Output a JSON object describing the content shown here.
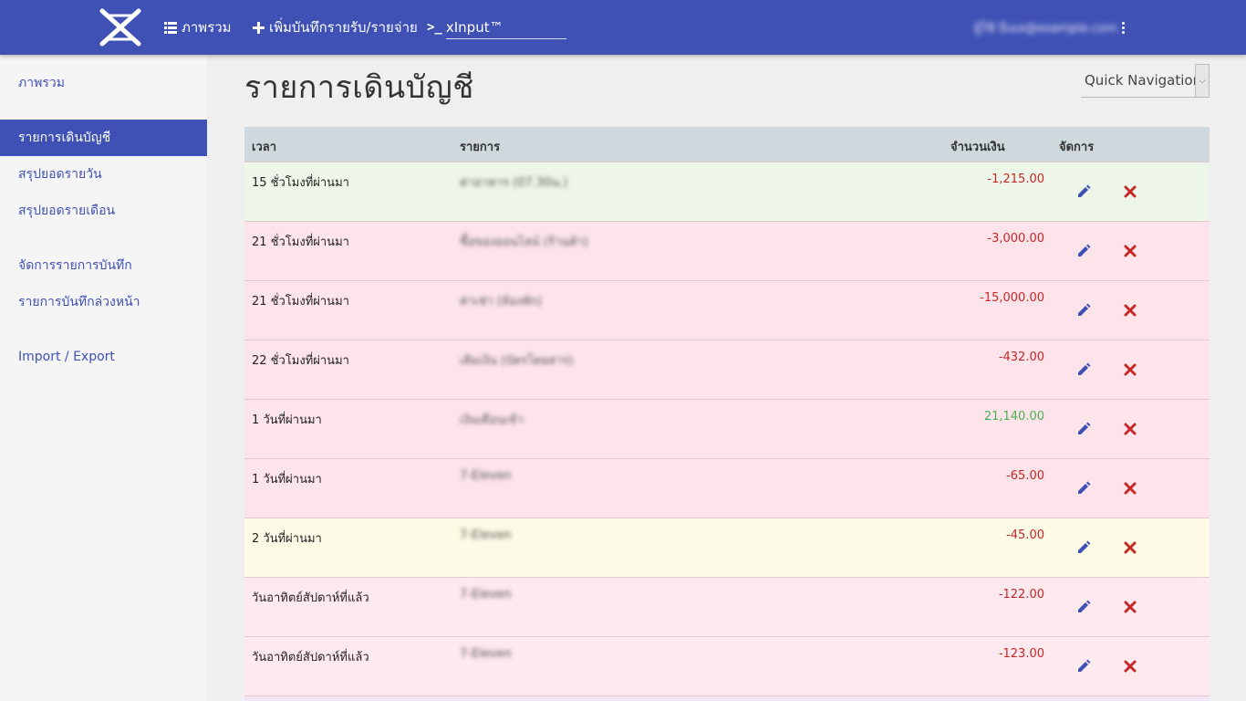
{
  "topbar": {
    "nav_overview": "ภาพรวม",
    "nav_add": "เพิ่มบันทึกรายรับ/รายจ่าย",
    "xinput_prompt": ">_",
    "xinput_value": "xInput™",
    "user_name": "ผู้ใช้ อีเมล@example.com"
  },
  "sidebar": {
    "items": [
      {
        "label": "ภาพรวม"
      },
      {
        "label": "รายการเดินบัญชี"
      },
      {
        "label": "สรุปยอดรายวัน"
      },
      {
        "label": "สรุปยอดรายเดือน"
      },
      {
        "label": "จัดการรายการบันทึก"
      },
      {
        "label": "รายการบันทึกล่วงหน้า"
      },
      {
        "label": "Import / Export"
      }
    ],
    "active_index": 1
  },
  "main": {
    "title": "รายการเดินบัญชี",
    "quick_nav": "Quick Navigation",
    "columns": {
      "time": "เวลา",
      "item": "รายการ",
      "amount": "จำนวนเงิน",
      "actions": "จัดการ"
    },
    "rows": [
      {
        "time": "15 ชั่วโมงที่ผ่านมา",
        "desc": "ค่าอาหาร (07.30น.)",
        "amount": "-1,215.00",
        "kind": "neg",
        "tone": "green"
      },
      {
        "time": "21 ชั่วโมงที่ผ่านมา",
        "desc": "ซื้อของออนไลน์ (ร้านค้า)",
        "amount": "-3,000.00",
        "kind": "neg",
        "tone": "pink"
      },
      {
        "time": "21 ชั่วโมงที่ผ่านมา",
        "desc": "ค่าเช่า (ห้องพัก)",
        "amount": "-15,000.00",
        "kind": "neg",
        "tone": "pink"
      },
      {
        "time": "22 ชั่วโมงที่ผ่านมา",
        "desc": "เติมเงิน (บัตรโดยสาร)",
        "amount": "-432.00",
        "kind": "neg",
        "tone": "pink"
      },
      {
        "time": "1 วันที่ผ่านมา",
        "desc": "เงินเดือนเข้า",
        "amount": "21,140.00",
        "kind": "pos",
        "tone": "pink"
      },
      {
        "time": "1 วันที่ผ่านมา",
        "desc": "7-Eleven",
        "amount": "-65.00",
        "kind": "neg",
        "tone": "pink"
      },
      {
        "time": "2 วันที่ผ่านมา",
        "desc": "7-Eleven",
        "amount": "-45.00",
        "kind": "neg",
        "tone": "yellow"
      },
      {
        "time": "วันอาทิตย์สัปดาห์ที่แล้ว",
        "desc": "7-Eleven",
        "amount": "-122.00",
        "kind": "neg",
        "tone": "pink2"
      },
      {
        "time": "วันอาทิตย์สัปดาห์ที่แล้ว",
        "desc": "7-Eleven",
        "amount": "-123.00",
        "kind": "neg",
        "tone": "pink2"
      }
    ]
  },
  "colors": {
    "primary": "#3f51b5",
    "negative": "#c62828",
    "positive": "#4caf50",
    "delete": "#c62828"
  },
  "icons": {
    "logo": "x-logo-icon",
    "overview": "list-icon",
    "add": "plus-icon",
    "edit": "pencil-icon",
    "delete": "close-icon",
    "menu": "kebab-menu-icon"
  }
}
